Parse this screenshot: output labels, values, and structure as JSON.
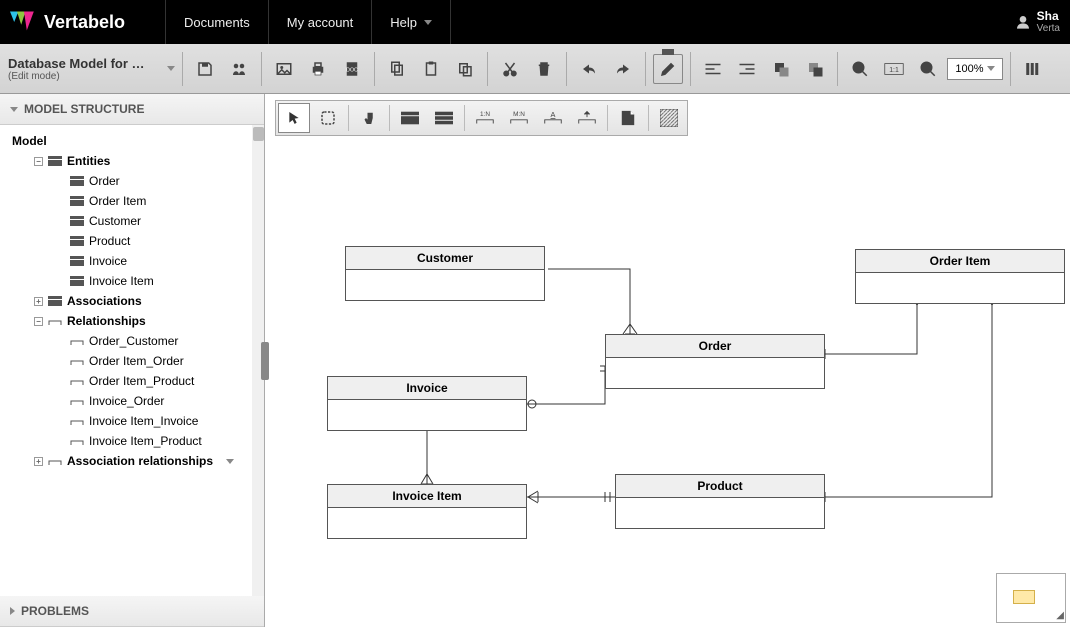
{
  "topnav": {
    "brand": "Vertabelo",
    "items": [
      "Documents",
      "My account",
      "Help"
    ],
    "user_name": "Sha",
    "user_sub": "Verta"
  },
  "toolbar": {
    "model_name": "Database Model for …",
    "model_sub": "(Edit mode)",
    "zoom": "100%"
  },
  "sidebar": {
    "panel1": "MODEL STRUCTURE",
    "panel2": "PROBLEMS",
    "root": "Model",
    "entities_label": "Entities",
    "entities": [
      "Order",
      "Order Item",
      "Customer",
      "Product",
      "Invoice",
      "Invoice Item"
    ],
    "associations_label": "Associations",
    "relationships_label": "Relationships",
    "relationships": [
      "Order_Customer",
      "Order Item_Order",
      "Order Item_Product",
      "Invoice_Order",
      "Invoice Item_Invoice",
      "Invoice Item_Product"
    ],
    "assoc_rel_label": "Association relationships"
  },
  "canvas": {
    "entities": {
      "customer": "Customer",
      "order": "Order",
      "order_item": "Order Item",
      "invoice": "Invoice",
      "invoice_item": "Invoice Item",
      "product": "Product"
    }
  }
}
